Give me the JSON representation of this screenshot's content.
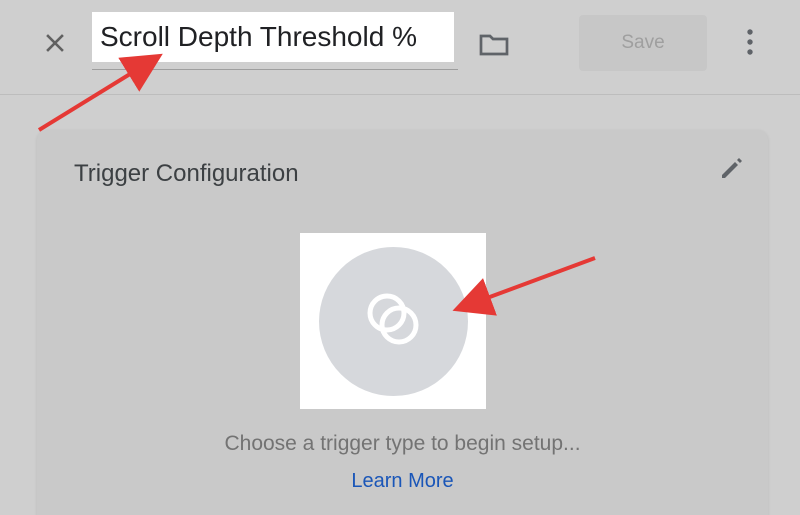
{
  "header": {
    "title_value": "Scroll Depth Threshold %",
    "save_label": "Save"
  },
  "card": {
    "title": "Trigger Configuration",
    "helper_text": "Choose a trigger type to begin setup...",
    "learn_more_label": "Learn More"
  },
  "icons": {
    "close": "close-icon",
    "folder": "folder-icon",
    "more": "more-vertical-icon",
    "edit": "edit-icon",
    "trigger": "trigger-overlap-icon"
  },
  "colors": {
    "background": "#cfcfcf",
    "card_background": "#c9c9c9",
    "title_text": "#202124",
    "accent_link": "#1a56b8",
    "annotation_arrow": "#e53935",
    "disabled_button_text": "#9f9f9f"
  }
}
